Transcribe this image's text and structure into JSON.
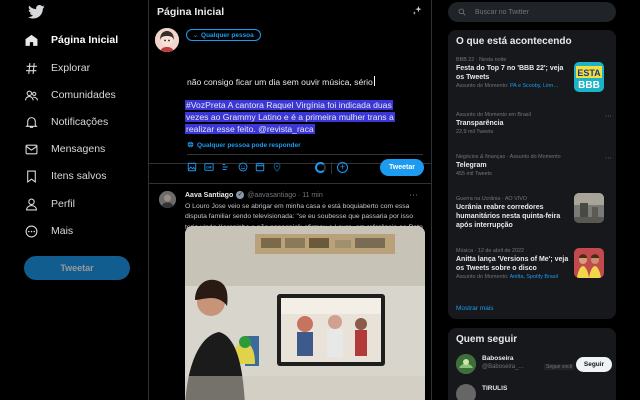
{
  "brand": {
    "accent": "#1d9bf0",
    "logo_icon": "bird-logo-icon"
  },
  "nav": {
    "items": [
      {
        "label": "Página Inicial",
        "icon": "home-icon",
        "active": true
      },
      {
        "label": "Explorar",
        "icon": "hashtag-icon"
      },
      {
        "label": "Comunidades",
        "icon": "communities-icon"
      },
      {
        "label": "Notificações",
        "icon": "bell-icon"
      },
      {
        "label": "Mensagens",
        "icon": "envelope-icon"
      },
      {
        "label": "Itens salvos",
        "icon": "bookmark-icon"
      },
      {
        "label": "Perfil",
        "icon": "person-icon"
      },
      {
        "label": "Mais",
        "icon": "more-circle-icon"
      }
    ],
    "tweet_button": "Tweetar"
  },
  "main": {
    "title": "Página Inicial",
    "compose": {
      "audience": "Qualquer pessoa",
      "draft_first_line": "não consigo ficar um dia sem ouvir música, sério",
      "selected_lines": [
        "#VozPreta A cantora Raquel Virgínia foi indicada duas",
        "vezes ao Grammy Latino e é a primeira mulher trans a",
        "realizar esse feito.  @revista_raca"
      ],
      "reply_setting": "Qualquer pessoa pode responder",
      "submit_label": "Tweetar"
    },
    "tweet": {
      "name": "Aava Santiago",
      "handle": "@aavasantiago · 11 min",
      "body": "O Louro Jose veio se abrigar em minha casa e está boquiaberto com essa disputa familiar sendo televisionada: \"se eu soubesse que passaria por isso teria vindo Xeropinho e não papagaio\"; afirmou o Louro, em referência ao Rato de Pelúcia famoso por apurar DNAs na emissora rival."
    }
  },
  "right": {
    "search_placeholder": "Buscar no Twitter",
    "trends_title": "O que está acontecendo",
    "trends": [
      {
        "context": "BBB 22 · Nesta noite",
        "title": "Festa do Top 7 no 'BBB 22'; veja os Tweets",
        "meta": "Assunto do Momento:",
        "meta_accent": "PA e Scooby, Linn…",
        "thumb": "bbb"
      },
      {
        "context": "Assunto do Momento em Brasil",
        "title": "Transparência",
        "meta": "22,9 mil Tweets"
      },
      {
        "context": "Negócios & finanças · Assunto do Momento",
        "title": "Telegram",
        "meta": "455 mil Tweets"
      },
      {
        "context": "Guerra na Ucrânia · AO VIVO",
        "title": "Ucrânia reabre corredores humanitários nesta quinta-feira após interrupção",
        "meta": "",
        "thumb": "ukraine"
      },
      {
        "context": "Música · 12 de abril de 2022",
        "title": "Anitta lança 'Versions of Me'; veja os Tweets sobre o disco",
        "meta": "Assunto do Momento:",
        "meta_accent": "Anitta, Spotify Brasil",
        "thumb": "anitta"
      }
    ],
    "show_more": "Mostrar mais",
    "follow_title": "Quem seguir",
    "follow": [
      {
        "name": "Baboseira",
        "handle": "@Baboseira_...",
        "badge": "Segue você",
        "button": "Seguir"
      },
      {
        "name": "TIRULIS",
        "handle": "",
        "badge": "",
        "button": ""
      }
    ]
  }
}
